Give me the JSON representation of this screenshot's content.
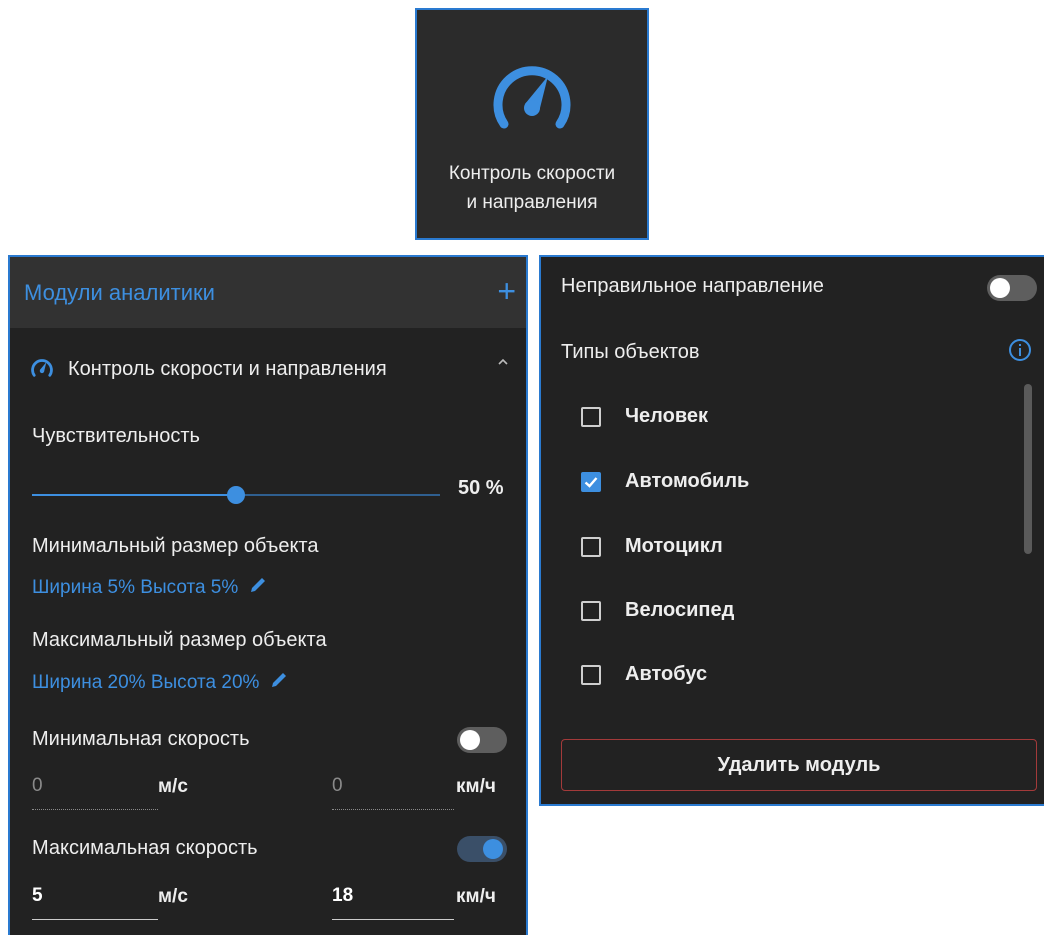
{
  "tile": {
    "title_line1": "Контроль скорости",
    "title_line2": "и направления",
    "icon": "speedometer-icon",
    "accent": "#3d8fe0"
  },
  "panel": {
    "title": "Модули аналитики",
    "add_icon": "plus-icon",
    "module": {
      "label": "Контроль скорости и направления",
      "icon": "speedometer-icon",
      "expand_icon": "chevron-up-icon"
    },
    "sensitivity": {
      "label": "Чувствительность",
      "value": 50,
      "value_text": "50 %"
    },
    "min_size": {
      "label": "Минимальный размер объекта",
      "value": "Ширина 5% Высота 5%",
      "edit_icon": "pencil-icon"
    },
    "max_size": {
      "label": "Максимальный размер объекта",
      "value": "Ширина 20% Высота 20%",
      "edit_icon": "pencil-icon"
    },
    "min_speed": {
      "label": "Минимальная скорость",
      "enabled": false,
      "ms": "0",
      "ms_unit": "м/с",
      "kmh": "0",
      "kmh_unit": "км/ч"
    },
    "max_speed": {
      "label": "Максимальная скорость",
      "enabled": true,
      "ms": "5",
      "ms_unit": "м/с",
      "kmh": "18",
      "kmh_unit": "км/ч"
    }
  },
  "right": {
    "wrong_direction": {
      "label": "Неправильное направление",
      "enabled": false
    },
    "object_types": {
      "label": "Типы объектов",
      "info_icon": "info-icon",
      "items": [
        {
          "label": "Человек",
          "checked": false
        },
        {
          "label": "Автомобиль",
          "checked": true
        },
        {
          "label": "Мотоцикл",
          "checked": false
        },
        {
          "label": "Велосипед",
          "checked": false
        },
        {
          "label": "Автобус",
          "checked": false
        }
      ]
    },
    "delete_button": "Удалить модуль"
  },
  "colors": {
    "panel_bg": "#222222",
    "header_bg": "#323232",
    "accent": "#3d8fe0",
    "border": "#2a7ad0",
    "danger": "#a33a3a"
  }
}
